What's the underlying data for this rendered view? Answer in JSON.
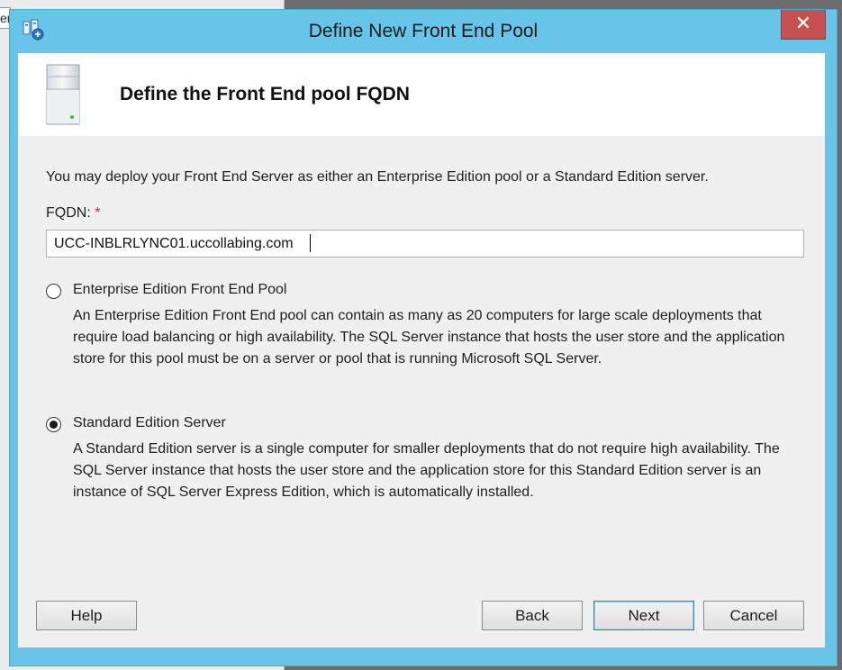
{
  "background_app": {
    "partial_text": "er"
  },
  "window": {
    "title": "Define New Front End Pool",
    "close_label": "✕"
  },
  "header": {
    "title": "Define the Front End pool FQDN"
  },
  "intro": "You may deploy your Front End Server as either an Enterprise Edition pool or a Standard Edition server.",
  "fqdn": {
    "label": "FQDN:",
    "required_marker": "*",
    "value": "UCC-INBLRLYNC01.uccollabing.com"
  },
  "options": [
    {
      "label": "Enterprise Edition Front End Pool",
      "selected": false,
      "description": "An Enterprise Edition Front End pool can contain as many as 20 computers for large scale deployments that require load balancing or high availability. The SQL Server instance that hosts the user store and the application store for this pool must be on a server or pool that is running Microsoft SQL Server."
    },
    {
      "label": "Standard Edition Server",
      "selected": true,
      "description": "A Standard Edition server is a single computer for smaller deployments that do not require high availability. The SQL Server instance that hosts the user store and the application store for this Standard Edition server is an instance of SQL Server Express Edition, which is automatically installed."
    }
  ],
  "buttons": {
    "help": "Help",
    "back": "Back",
    "next": "Next",
    "cancel": "Cancel"
  },
  "icons": {
    "app": "topology-builder-icon",
    "header": "server-icon"
  },
  "colors": {
    "titlebar": "#66c5e8",
    "close": "#c75050",
    "client_bg": "#f0f0f0",
    "required": "#d03232"
  }
}
